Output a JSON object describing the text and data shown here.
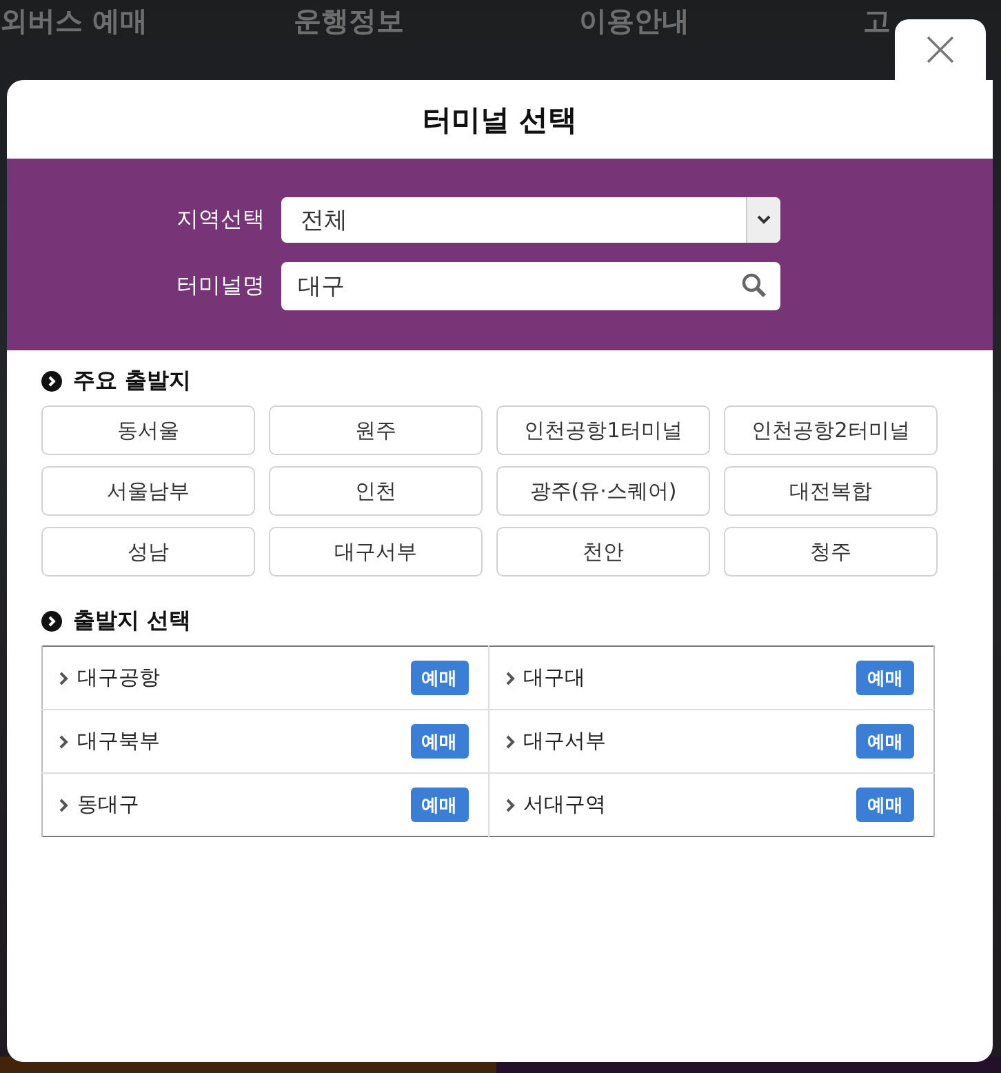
{
  "background_nav": [
    "외버스 예매",
    "운행정보",
    "이용안내",
    "고"
  ],
  "dialog": {
    "title": "터미널 선택",
    "region": {
      "label": "지역선택",
      "value": "전체"
    },
    "terminal": {
      "label": "터미널명",
      "value": "대구"
    },
    "major_departures": {
      "heading": "주요 출발지",
      "items": [
        "동서울",
        "원주",
        "인천공항1터미널",
        "인천공항2터미널",
        "서울남부",
        "인천",
        "광주(유·스퀘어)",
        "대전복합",
        "성남",
        "대구서부",
        "천안",
        "청주"
      ]
    },
    "departure_select": {
      "heading": "출발지 선택",
      "items": [
        {
          "name": "대구공항",
          "action": "예매"
        },
        {
          "name": "대구대",
          "action": "예매"
        },
        {
          "name": "대구북부",
          "action": "예매"
        },
        {
          "name": "대구서부",
          "action": "예매"
        },
        {
          "name": "동대구",
          "action": "예매"
        },
        {
          "name": "서대구역",
          "action": "예매"
        }
      ]
    }
  }
}
